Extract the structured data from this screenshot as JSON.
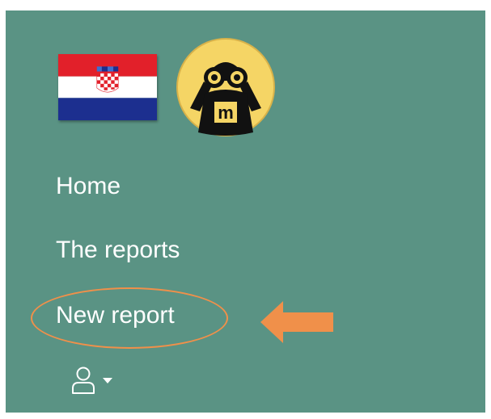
{
  "nav": {
    "items": [
      {
        "label": "Home"
      },
      {
        "label": "The reports"
      },
      {
        "label": "New report"
      }
    ]
  },
  "annotation": {
    "highlighted_item": "New report",
    "highlight_color": "#f0904a"
  },
  "header": {
    "flag_icon": "croatia-flag-icon",
    "logo_icon": "binoculars-observer-logo-icon",
    "logo_letter": "m"
  },
  "user_menu": {
    "icon": "user-icon",
    "dropdown_icon": "caret-down-icon"
  },
  "colors": {
    "background": "#5a9384",
    "text": "#ffffff",
    "accent": "#f0904a",
    "logo_fill": "#f5d565"
  }
}
